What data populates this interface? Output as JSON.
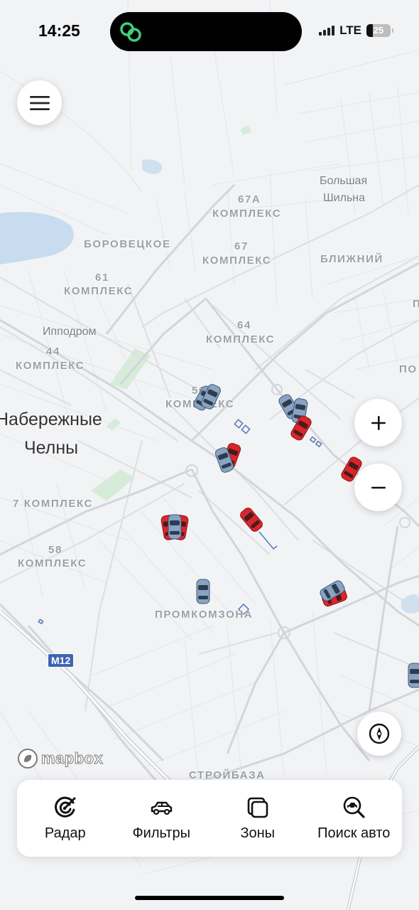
{
  "status_bar": {
    "time": "14:25",
    "network": "LTE",
    "battery": "25"
  },
  "map": {
    "city_label_line1": "Набережные",
    "city_label_line2": "Челны",
    "labels": [
      {
        "id": "bolshaya-1",
        "text": "Большая",
        "style": "place"
      },
      {
        "id": "bolshaya-2",
        "text": "Шильна",
        "style": "place"
      },
      {
        "id": "n67a",
        "text": "67А",
        "style": "number"
      },
      {
        "id": "k67a",
        "text": "КОМПЛЕКС",
        "style": "district"
      },
      {
        "id": "borovetskoe",
        "text": "БОРОВЕЦКОЕ",
        "style": "district"
      },
      {
        "id": "n67",
        "text": "67",
        "style": "number"
      },
      {
        "id": "k67",
        "text": "КОМПЛЕКС",
        "style": "district"
      },
      {
        "id": "blizhny",
        "text": "БЛИЖНИЙ",
        "style": "district"
      },
      {
        "id": "n61",
        "text": "61",
        "style": "number"
      },
      {
        "id": "k61",
        "text": "КОМПЛЕКС",
        "style": "district"
      },
      {
        "id": "n64",
        "text": "64",
        "style": "number"
      },
      {
        "id": "k64",
        "text": "КОМПЛЕКС",
        "style": "district"
      },
      {
        "id": "ippodrom",
        "text": "Ипподром",
        "style": "place"
      },
      {
        "id": "n44",
        "text": "44",
        "style": "number"
      },
      {
        "id": "k44",
        "text": "КОМПЛЕКС",
        "style": "district"
      },
      {
        "id": "n56",
        "text": "56",
        "style": "number"
      },
      {
        "id": "k56",
        "text": "КОМПЛЕКС",
        "style": "district"
      },
      {
        "id": "k7",
        "text": "7 КОМПЛЕКС",
        "style": "district"
      },
      {
        "id": "n58",
        "text": "58",
        "style": "number"
      },
      {
        "id": "k58",
        "text": "КОМПЛЕКС",
        "style": "district"
      },
      {
        "id": "promkomzona",
        "text": "ПРОМКОМЗОНА",
        "style": "district"
      },
      {
        "id": "stroibaza",
        "text": "СТРОЙБАЗА",
        "style": "district"
      },
      {
        "id": "po",
        "text": "ПО",
        "style": "district"
      },
      {
        "id": "p-edge",
        "text": "П",
        "style": "district"
      }
    ],
    "route_badge": "M12"
  },
  "attribution": "mapbox",
  "nav": [
    {
      "label": "Радар",
      "icon": "radar-icon"
    },
    {
      "label": "Фильтры",
      "icon": "car-icon"
    },
    {
      "label": "Зоны",
      "icon": "zones-icon"
    },
    {
      "label": "Поиск авто",
      "icon": "car-search-icon"
    }
  ],
  "colors": {
    "car_red": "#d9262b",
    "car_blue": "#8aa3c2",
    "map_bg": "#f2f3f5",
    "park": "#d6ecd8",
    "water": "#c8dcf0"
  }
}
